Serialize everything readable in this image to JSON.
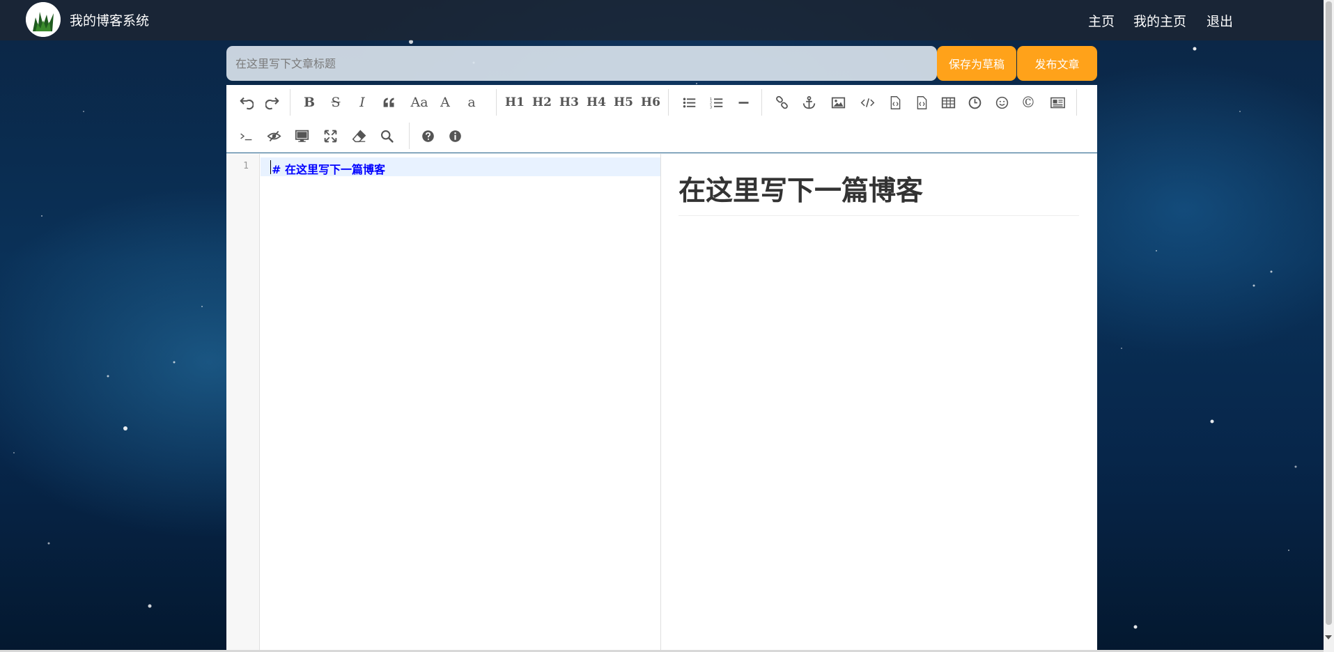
{
  "navbar": {
    "brand": "我的博客系统",
    "links": [
      {
        "label": "主页"
      },
      {
        "label": "我的主页"
      },
      {
        "label": "退出"
      }
    ]
  },
  "title_row": {
    "placeholder": "在这里写下文章标题",
    "value": "",
    "save_draft_label": "保存为草稿",
    "publish_label": "发布文章"
  },
  "toolbar": {
    "row1": [
      {
        "icon": "undo-icon",
        "label": ""
      },
      {
        "icon": "redo-icon",
        "label": ""
      },
      {
        "icon": "bold-icon",
        "label": "B"
      },
      {
        "icon": "strikethrough-icon",
        "label": "S"
      },
      {
        "icon": "italic-icon",
        "label": "I"
      },
      {
        "icon": "quote-icon",
        "label": ""
      },
      {
        "icon": "uppercase-icon",
        "label": "Aa"
      },
      {
        "icon": "ucwords-icon",
        "label": "A"
      },
      {
        "icon": "lowercase-icon",
        "label": "a"
      },
      {
        "icon": "h1-icon",
        "label": "H1"
      },
      {
        "icon": "h2-icon",
        "label": "H2"
      },
      {
        "icon": "h3-icon",
        "label": "H3"
      },
      {
        "icon": "h4-icon",
        "label": "H4"
      },
      {
        "icon": "h5-icon",
        "label": "H5"
      },
      {
        "icon": "h6-icon",
        "label": "H6"
      },
      {
        "icon": "unordered-list-icon",
        "label": ""
      },
      {
        "icon": "ordered-list-icon",
        "label": ""
      },
      {
        "icon": "horizontal-rule-icon",
        "label": ""
      },
      {
        "icon": "link-icon",
        "label": ""
      },
      {
        "icon": "anchor-icon",
        "label": ""
      },
      {
        "icon": "image-icon",
        "label": ""
      },
      {
        "icon": "inline-code-icon",
        "label": ""
      },
      {
        "icon": "code-block-icon",
        "label": ""
      },
      {
        "icon": "preformatted-text-icon",
        "label": ""
      },
      {
        "icon": "table-icon",
        "label": ""
      },
      {
        "icon": "datetime-icon",
        "label": ""
      },
      {
        "icon": "emoji-icon",
        "label": ""
      },
      {
        "icon": "html-entities-icon",
        "label": "©"
      },
      {
        "icon": "pagebreak-icon",
        "label": ""
      }
    ],
    "row2": [
      {
        "icon": "goto-line-icon",
        "label": ""
      },
      {
        "icon": "toggle-preview-icon",
        "label": ""
      },
      {
        "icon": "watch-icon",
        "label": ""
      },
      {
        "icon": "fullscreen-icon",
        "label": ""
      },
      {
        "icon": "clear-icon",
        "label": ""
      },
      {
        "icon": "search-icon",
        "label": ""
      },
      {
        "icon": "help-icon",
        "label": ""
      },
      {
        "icon": "info-icon",
        "label": ""
      }
    ]
  },
  "editor": {
    "line_number": "1",
    "code_line": "#  在这里写下一篇博客"
  },
  "preview": {
    "heading": "在这里写下一篇博客"
  },
  "colors": {
    "accent_button": "#ffa21a",
    "code_heading": "#0000ff",
    "toolbar_border": "#1c5a86"
  }
}
